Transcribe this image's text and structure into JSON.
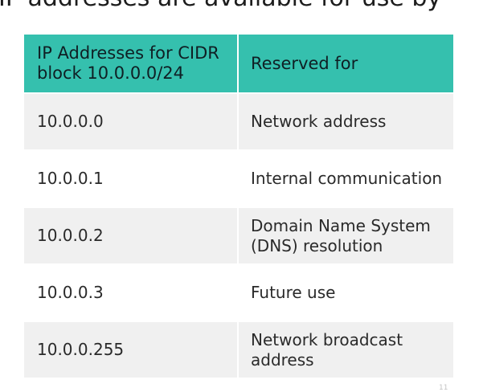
{
  "slide": {
    "title_partial": "IP addresses are available for use by"
  },
  "table": {
    "header": {
      "col1": "IP Addresses for CIDR block 10.0.0.0/24",
      "col2": "Reserved for"
    },
    "rows": [
      {
        "ip": "10.0.0.0",
        "reserved": "Network address"
      },
      {
        "ip": "10.0.0.1",
        "reserved": "Internal communication"
      },
      {
        "ip": "10.0.0.2",
        "reserved": "Domain Name System (DNS) resolution"
      },
      {
        "ip": "10.0.0.3",
        "reserved": "Future use"
      },
      {
        "ip": "10.0.0.255",
        "reserved": "Network broadcast address"
      }
    ]
  },
  "colors": {
    "header_bg": "#35c0ae",
    "row_shaded": "#f0f0f0",
    "row_plain": "#ffffff"
  },
  "watermark": "11"
}
